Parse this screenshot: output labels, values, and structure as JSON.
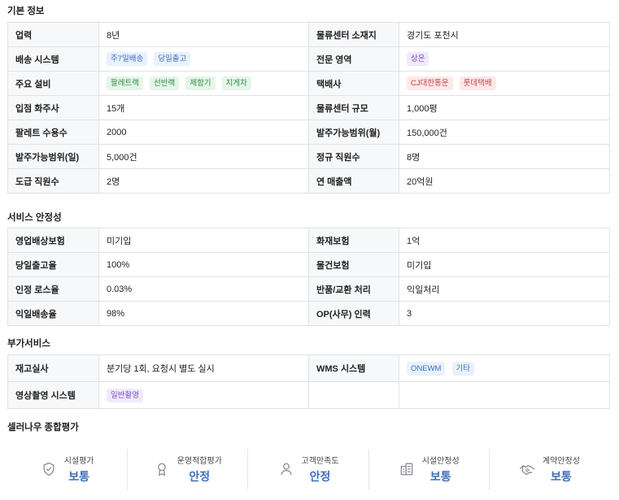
{
  "sections": {
    "basic": "기본 정보",
    "service": "서비스 안정성",
    "extra": "부가서비스",
    "eval": "셀러나우 종합평가"
  },
  "basic": {
    "career_label": "업력",
    "career_value": "8년",
    "location_label": "물류센터 소재지",
    "location_value": "경기도 포천시",
    "delivery_label": "배송 시스템",
    "delivery_tags": [
      "주7일배송",
      "당일출고"
    ],
    "specialty_label": "전문 영역",
    "specialty_tags": [
      "상온"
    ],
    "equipment_label": "주요 설비",
    "equipment_tags": [
      "팔레트랙",
      "선반랙",
      "제함기",
      "지게차"
    ],
    "courier_label": "택배사",
    "courier_tags": [
      "CJ대한통운",
      "롯데택배"
    ],
    "clients_label": "입점 화주사",
    "clients_value": "15개",
    "size_label": "물류센터 규모",
    "size_value": "1,000평",
    "pallet_label": "팔레트 수용수",
    "pallet_value": "2000",
    "monthly_label": "발주가능범위(월)",
    "monthly_value": "150,000건",
    "daily_label": "발주가능범위(일)",
    "daily_value": "5,000건",
    "regular_label": "정규 직원수",
    "regular_value": "8명",
    "contract_label": "도급 직원수",
    "contract_value": "2명",
    "sales_label": "연 매출액",
    "sales_value": "20억원"
  },
  "service": {
    "biz_ins_label": "영업배상보험",
    "biz_ins_value": "미기입",
    "fire_ins_label": "화재보험",
    "fire_ins_value": "1억",
    "sameday_label": "당일출고율",
    "sameday_value": "100%",
    "cargo_ins_label": "물건보험",
    "cargo_ins_value": "미기입",
    "loss_label": "인정 로스율",
    "loss_value": "0.03%",
    "return_label": "반품/교환 처리",
    "return_value": "익일처리",
    "nextday_label": "익일배송율",
    "nextday_value": "98%",
    "op_label": "OP(사무) 인력",
    "op_value": "3"
  },
  "extra": {
    "inventory_label": "재고실사",
    "inventory_value": "분기당 1회, 요청시 별도 실시",
    "wms_label": "WMS 시스템",
    "wms_tags": [
      "ONEWM",
      "기타"
    ],
    "video_label": "영상촬영 시스템",
    "video_tags": [
      "일반촬영"
    ]
  },
  "evaluation": [
    {
      "label": "시설평가",
      "value": "보통",
      "icon": "shield-icon"
    },
    {
      "label": "운영적합평가",
      "value": "안정",
      "icon": "award-icon"
    },
    {
      "label": "고객만족도",
      "value": "안정",
      "icon": "user-icon"
    },
    {
      "label": "시설안정성",
      "value": "보통",
      "icon": "building-icon"
    },
    {
      "label": "계약안정성",
      "value": "보통",
      "icon": "handshake-icon"
    }
  ],
  "colors": {
    "accent_blue": "#3e6fb8",
    "tag_blue": "#3b6fc6",
    "tag_green": "#2f8a47",
    "tag_purple": "#7a4cc4",
    "tag_red": "#c4474a"
  }
}
